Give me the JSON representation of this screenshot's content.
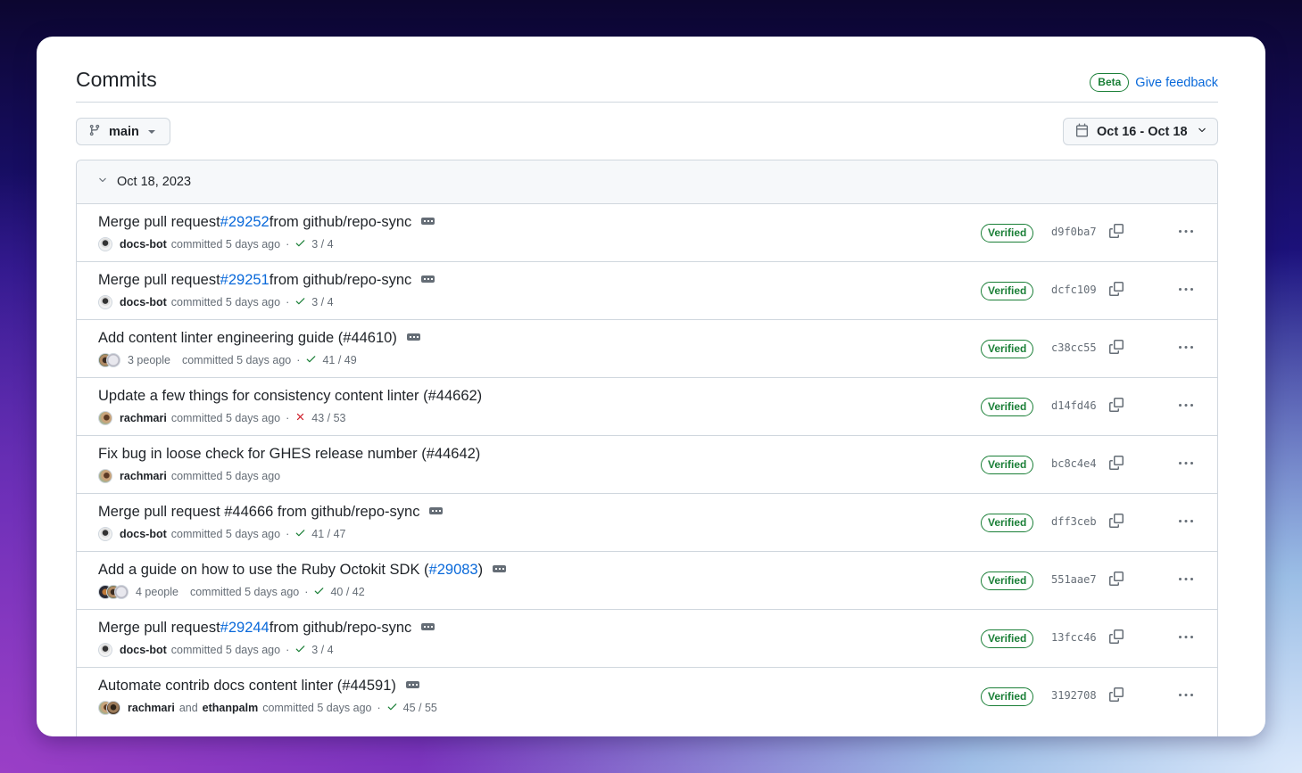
{
  "header": {
    "title": "Commits",
    "beta_label": "Beta",
    "feedback_label": "Give feedback"
  },
  "toolbar": {
    "branch": "main",
    "date_range": "Oct 16 - Oct 18"
  },
  "group": {
    "date": "Oct 18, 2023",
    "commits": [
      {
        "title_prefix": "Merge pull request ",
        "pr_link": "#29252",
        "title_suffix": " from github/repo-sync",
        "has_ellipsis": true,
        "avatars": [
          "docs-bot"
        ],
        "author": "docs-bot",
        "people": "",
        "coauthor": "",
        "committed": "committed 5 days ago",
        "status": "success",
        "checks": "3 / 4",
        "verified": "Verified",
        "sha": "d9f0ba7"
      },
      {
        "title_prefix": "Merge pull request ",
        "pr_link": "#29251",
        "title_suffix": " from github/repo-sync",
        "has_ellipsis": true,
        "avatars": [
          "docs-bot"
        ],
        "author": "docs-bot",
        "people": "",
        "coauthor": "",
        "committed": "committed 5 days ago",
        "status": "success",
        "checks": "3 / 4",
        "verified": "Verified",
        "sha": "dcfc109"
      },
      {
        "title_prefix": "Add content linter engineering guide (#44610)",
        "pr_link": "",
        "title_suffix": "",
        "has_ellipsis": true,
        "avatars": [
          "p1",
          "p3"
        ],
        "author": "",
        "people": "3 people",
        "coauthor": "",
        "committed": "committed 5 days ago",
        "status": "success",
        "checks": "41 / 49",
        "verified": "Verified",
        "sha": "c38cc55"
      },
      {
        "title_prefix": "Update a few things for consistency content linter (#44662)",
        "pr_link": "",
        "title_suffix": "",
        "has_ellipsis": false,
        "avatars": [
          "rachmari"
        ],
        "author": "rachmari",
        "people": "",
        "coauthor": "",
        "committed": "committed 5 days ago",
        "status": "failure",
        "checks": "43 / 53",
        "verified": "Verified",
        "sha": "d14fd46"
      },
      {
        "title_prefix": "Fix bug in loose check for GHES release number (#44642)",
        "pr_link": "",
        "title_suffix": "",
        "has_ellipsis": false,
        "avatars": [
          "rachmari"
        ],
        "author": "rachmari",
        "people": "",
        "coauthor": "",
        "committed": "committed 5 days ago",
        "status": "none",
        "checks": "",
        "verified": "Verified",
        "sha": "bc8c4e4"
      },
      {
        "title_prefix": "Merge pull request #44666 from github/repo-sync",
        "pr_link": "",
        "title_suffix": "",
        "has_ellipsis": true,
        "avatars": [
          "docs-bot"
        ],
        "author": "docs-bot",
        "people": "",
        "coauthor": "",
        "committed": "committed 5 days ago",
        "status": "success",
        "checks": "41 / 47",
        "verified": "Verified",
        "sha": "dff3ceb"
      },
      {
        "title_prefix": "Add a guide on how to use the Ruby Octokit SDK (",
        "pr_link": "#29083",
        "title_suffix": ")",
        "has_ellipsis": true,
        "avatars": [
          "p2",
          "p1",
          "p3"
        ],
        "author": "",
        "people": "4 people",
        "coauthor": "",
        "committed": "committed 5 days ago",
        "status": "success",
        "checks": "40 / 42",
        "verified": "Verified",
        "sha": "551aae7"
      },
      {
        "title_prefix": "Merge pull request ",
        "pr_link": "#29244",
        "title_suffix": " from github/repo-sync",
        "has_ellipsis": true,
        "avatars": [
          "docs-bot"
        ],
        "author": "docs-bot",
        "people": "",
        "coauthor": "",
        "committed": "committed 5 days ago",
        "status": "success",
        "checks": "3 / 4",
        "verified": "Verified",
        "sha": "13fcc46"
      },
      {
        "title_prefix": "Automate contrib docs content linter (#44591)",
        "pr_link": "",
        "title_suffix": "",
        "has_ellipsis": true,
        "avatars": [
          "rachmari",
          "ethanpalm"
        ],
        "author": "rachmari",
        "people": "",
        "and_label": "and",
        "coauthor": "ethanpalm",
        "committed": "committed 5 days ago",
        "status": "success",
        "checks": "45 / 55",
        "verified": "Verified",
        "sha": "3192708"
      }
    ]
  },
  "colors": {
    "link": "#0969da",
    "success": "#1a7f37",
    "failure": "#cf222e",
    "muted": "#656d76",
    "text": "#1f2328",
    "border": "#d0d7de"
  },
  "icons": {
    "branch": "git-branch-icon",
    "caret": "triangle-down-icon",
    "calendar": "calendar-icon",
    "chevron": "chevron-down-icon",
    "check": "check-icon",
    "x": "x-icon",
    "copy": "copy-icon",
    "more": "kebab-horizontal-icon",
    "ellipsis": "ellipsis-icon"
  }
}
